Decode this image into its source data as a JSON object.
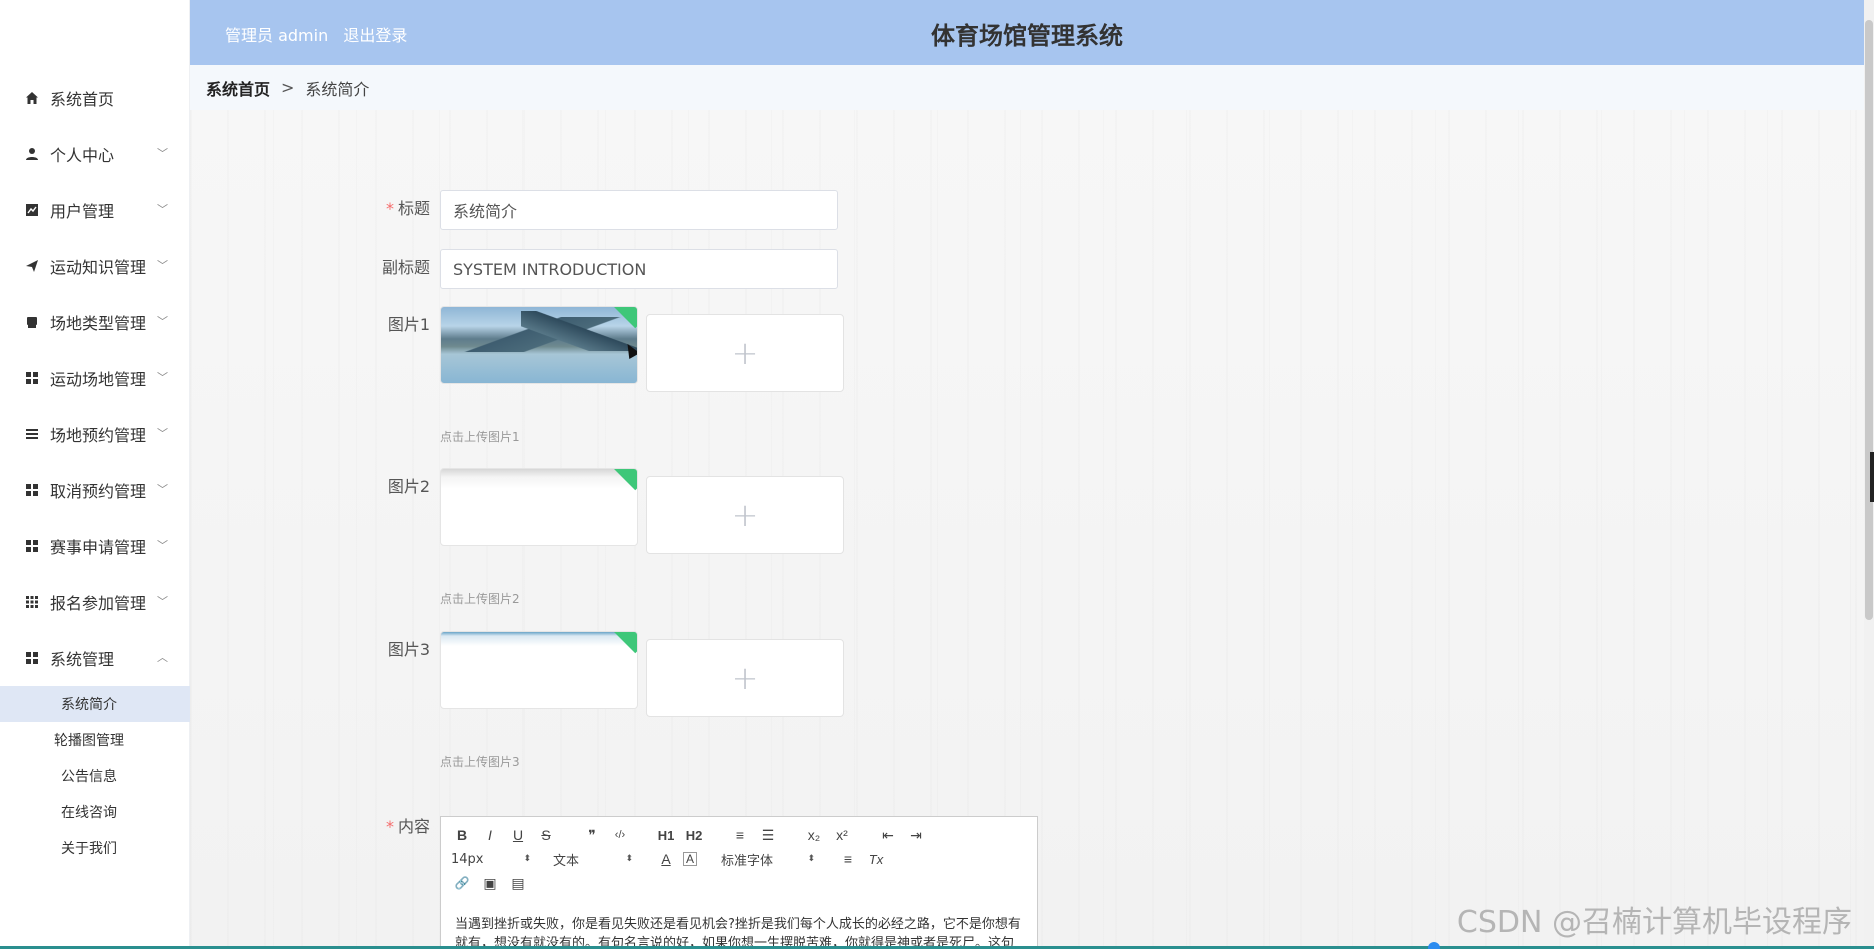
{
  "header": {
    "user_label": "管理员 admin",
    "logout": "退出登录",
    "title": "体育场馆管理系统"
  },
  "breadcrumb": {
    "home": "系统首页",
    "separator": ">",
    "current": "系统简介"
  },
  "sidebar": {
    "items": [
      {
        "label": "系统首页",
        "icon": "home-icon"
      },
      {
        "label": "个人中心",
        "icon": "user-icon"
      },
      {
        "label": "用户管理",
        "icon": "chart-icon"
      },
      {
        "label": "运动知识管理",
        "icon": "send-icon"
      },
      {
        "label": "场地类型管理",
        "icon": "bookmark-icon"
      },
      {
        "label": "运动场地管理",
        "icon": "grid-icon"
      },
      {
        "label": "场地预约管理",
        "icon": "list-icon"
      },
      {
        "label": "取消预约管理",
        "icon": "grid-icon"
      },
      {
        "label": "赛事申请管理",
        "icon": "grid-icon"
      },
      {
        "label": "报名参加管理",
        "icon": "apps-icon"
      },
      {
        "label": "系统管理",
        "icon": "grid-icon"
      }
    ],
    "sub_items": [
      {
        "label": "系统简介",
        "active": true
      },
      {
        "label": "轮播图管理",
        "active": false
      },
      {
        "label": "公告信息",
        "active": false
      },
      {
        "label": "在线咨询",
        "active": false
      },
      {
        "label": "关于我们",
        "active": false
      }
    ]
  },
  "form": {
    "title_label": "标题",
    "title_value": "系统简介",
    "subtitle_label": "副标题",
    "subtitle_value": "SYSTEM INTRODUCTION",
    "image1_label": "图片1",
    "image1_tip": "点击上传图片1",
    "image2_label": "图片2",
    "image2_tip": "点击上传图片2",
    "image3_label": "图片3",
    "image3_tip": "点击上传图片3",
    "content_label": "内容",
    "required_mark": "*",
    "upload_plus": "+"
  },
  "editor": {
    "toolbar_row1": [
      "B",
      "I",
      "U",
      "S",
      "❞",
      "‹/›",
      "H1",
      "H2",
      "≡",
      "☰",
      "x₂",
      "x²",
      "⇤",
      "⇥"
    ],
    "font_size": "14px",
    "text_type": "文本",
    "font_family": "标准字体",
    "select_arrows": "⬍",
    "color_glyph": "A",
    "bg_color_glyph": "A",
    "align_glyph": "≡",
    "clear_glyph": "Tx",
    "link_glyph": "🔗",
    "image_glyph": "▣",
    "video_glyph": "▤",
    "content_line1": "当遇到挫折或失败，你是看见失败还是看见机会?挫折是我们每个人成长的必经之路，它不是你想有",
    "content_line2": "就有，想没有就没有的。有句名言说的好，如果你想一生摆脱苦难，你就得是神或者是死尸。这句"
  },
  "watermark": "CSDN @召楠计算机毕设程序"
}
